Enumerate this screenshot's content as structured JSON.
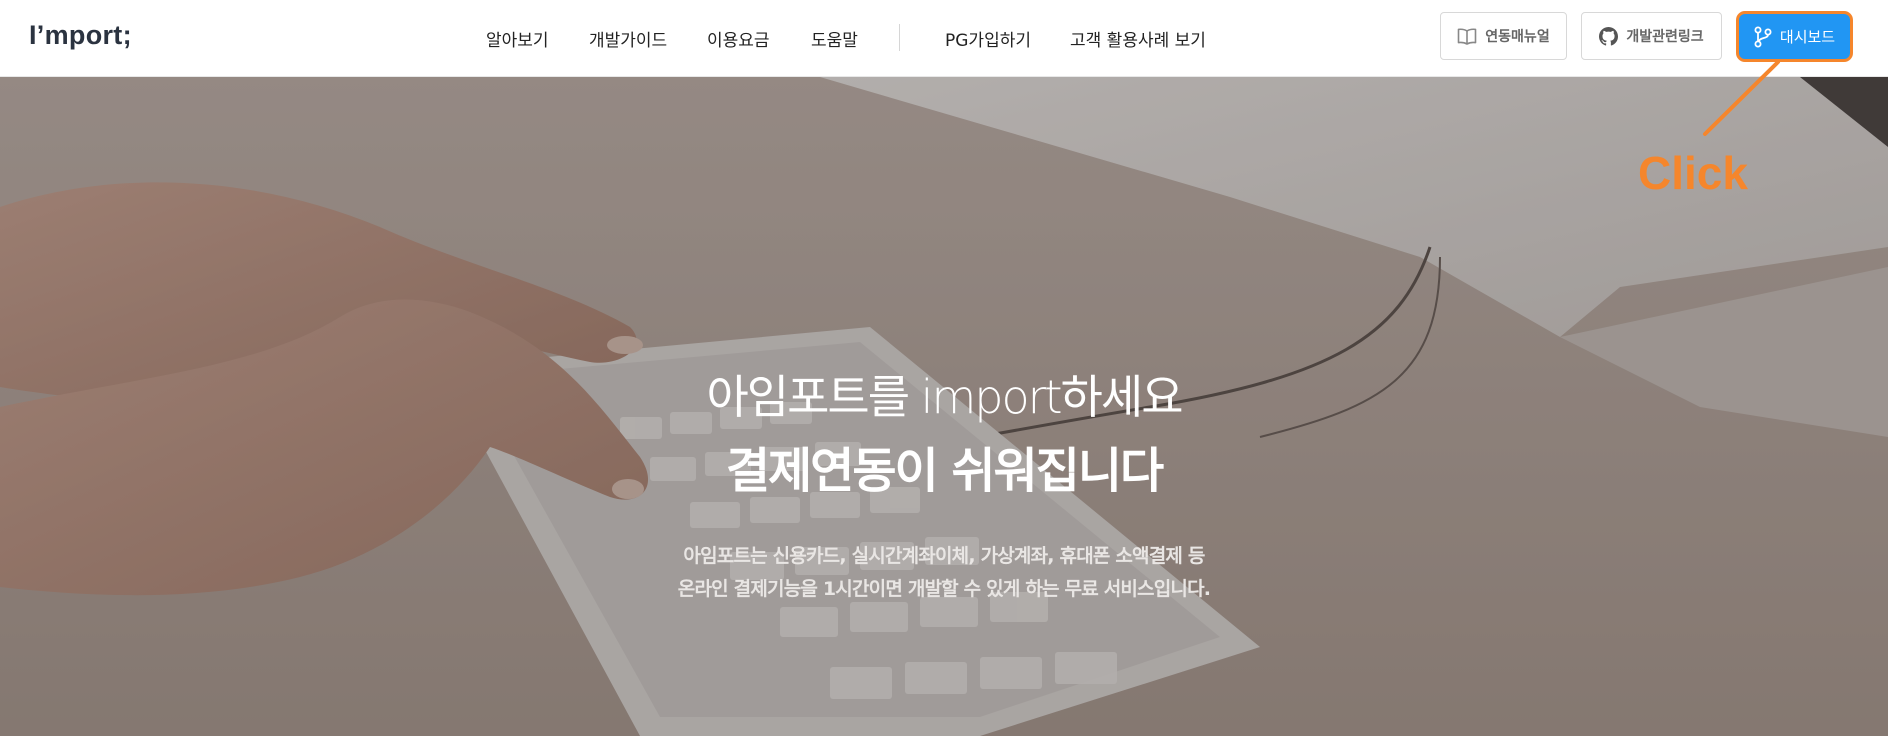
{
  "header": {
    "logo": "I’mport;",
    "nav": [
      "알아보기",
      "개발가이드",
      "이용요금",
      "도움말",
      "PG가입하기",
      "고객 활용사례 보기"
    ],
    "buttons": {
      "manual": "연동매뉴얼",
      "links": "개발관련링크",
      "dashboard": "대시보드"
    }
  },
  "hero": {
    "title_line1": "아임포트를 import하세요",
    "title_line2": "결제연동이 쉬워집니다",
    "desc_line1": "아임포트는 신용카드, 실시간계좌이체, 가상계좌, 휴대폰 소액결제 등",
    "desc_line2": "온라인 결제기능을 1시간이면 개발할 수 있게 하는 무료 서비스입니다."
  },
  "annotation": {
    "label": "Click",
    "color": "#f5862c"
  },
  "colors": {
    "accent": "#2196f3",
    "annotation": "#f5862c"
  },
  "icons": {
    "manual": "book-icon",
    "links": "github-icon",
    "dashboard": "branch-icon"
  }
}
